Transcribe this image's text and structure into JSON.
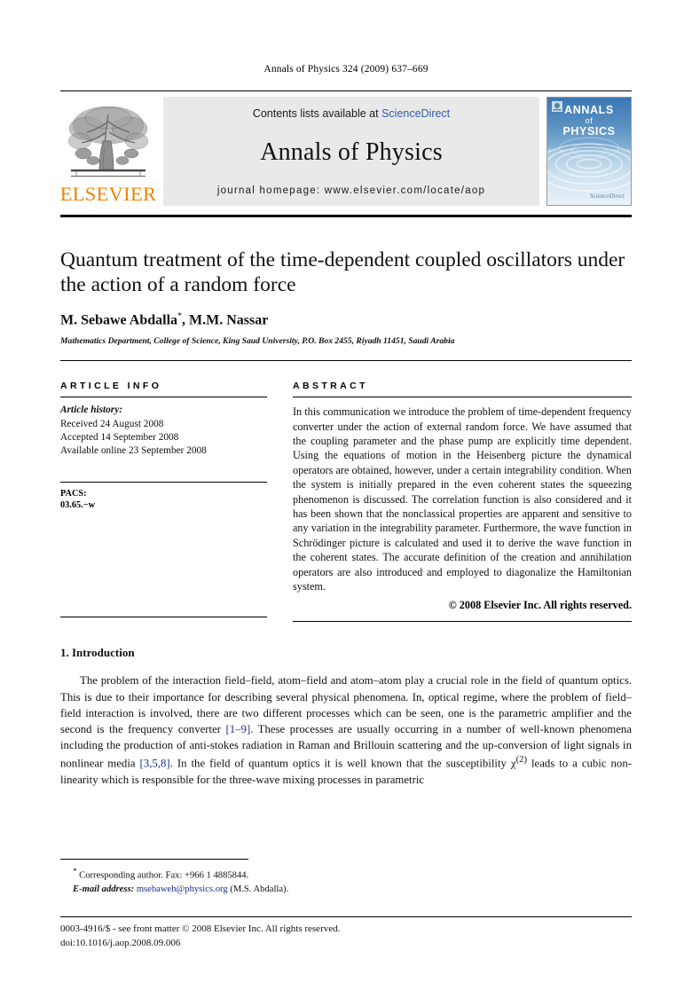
{
  "running_head": "Annals of Physics 324 (2009) 637–669",
  "header": {
    "contents_prefix": "Contents lists available at ",
    "sciencedirect": "ScienceDirect",
    "journal_title": "Annals of Physics",
    "homepage": "journal homepage: www.elsevier.com/locate/aop",
    "publisher_word": "ELSEVIER",
    "publisher_logo_icon": "elsevier-tree-icon",
    "cover": {
      "line1": "ANNALS",
      "line2": "of",
      "line3": "PHYSICS",
      "bottom_mark": "ScienceDirect"
    }
  },
  "colors": {
    "elsevier_orange": "#ef8200",
    "link_blue": "#2f5ca6",
    "reference_blue": "#1a2f8c",
    "band_gray": "#e9e9e9",
    "cover_blue": "#3b76b4"
  },
  "title_block": {
    "title": "Quantum treatment of the time-dependent coupled oscillators under the action of a random force",
    "authors": "M. Sebawe  Abdalla",
    "author_marker": "*",
    "authors_rest": ", M.M. Nassar",
    "affiliation": "Mathematics Department, College of Science, King Saud University, P.O. Box 2455, Riyadh 11451, Saudi Arabia"
  },
  "article_info": {
    "label": "ARTICLE INFO",
    "history_label": "Article history:",
    "history": [
      "Received 24 August 2008",
      "Accepted 14 September 2008",
      "Available online 23 September 2008"
    ],
    "pacs_label": "PACS:",
    "pacs_value": "03.65.−w"
  },
  "abstract": {
    "label": "ABSTRACT",
    "text": "In this communication we introduce the problem of time-dependent frequency converter under the action of external random force. We have assumed that the coupling parameter and the phase pump are explicitly time dependent. Using the equations of motion in the Heisenberg picture the dynamical operators are obtained, however, under a certain integrability condition. When the system is initially prepared in the even coherent states the squeezing phenomenon is discussed. The correlation function is also considered and it has been shown that the nonclassical properties are apparent and sensitive to any variation in the integrability parameter. Furthermore, the wave function in Schrödinger picture is calculated and used it to derive the wave function in the coherent states. The accurate definition of the creation and annihilation operators are also introduced and employed to diagonalize the Hamiltonian system.",
    "copyright": "© 2008 Elsevier Inc. All rights reserved."
  },
  "introduction": {
    "heading": "1. Introduction",
    "para_part1": "The problem of the interaction field–field, atom–field and atom–atom play a crucial role in the field of quantum optics. This is due to their importance for describing several physical phenomena. In, optical regime, where the problem of field–field interaction is involved, there are two different processes which can be seen, one is the parametric amplifier and the second is the frequency converter ",
    "ref1": "[1–9]",
    "para_part2": ". These processes are usually occurring in a number of well-known phenomena including the production of anti-stokes radiation in Raman and Brillouin scattering and the up-conversion of light signals in nonlinear media ",
    "ref2": "[3,5,8]",
    "para_part3": ". In the field of quantum optics it is well known that the susceptibility χ",
    "superscript": "(2)",
    "para_part4": " leads to a cubic non-linearity which is responsible for the three-wave mixing processes in parametric"
  },
  "footnote": {
    "marker": "*",
    "corresponding": "Corresponding author. Fax: +966 1 4885844.",
    "email_label": "E-mail address:",
    "email": "msebaweh@physics.org",
    "email_suffix": "(M.S.  Abdalla)."
  },
  "footer": {
    "issn_line": "0003-4916/$ - see front matter © 2008 Elsevier Inc. All rights reserved.",
    "doi_line": "doi:10.1016/j.aop.2008.09.006"
  }
}
